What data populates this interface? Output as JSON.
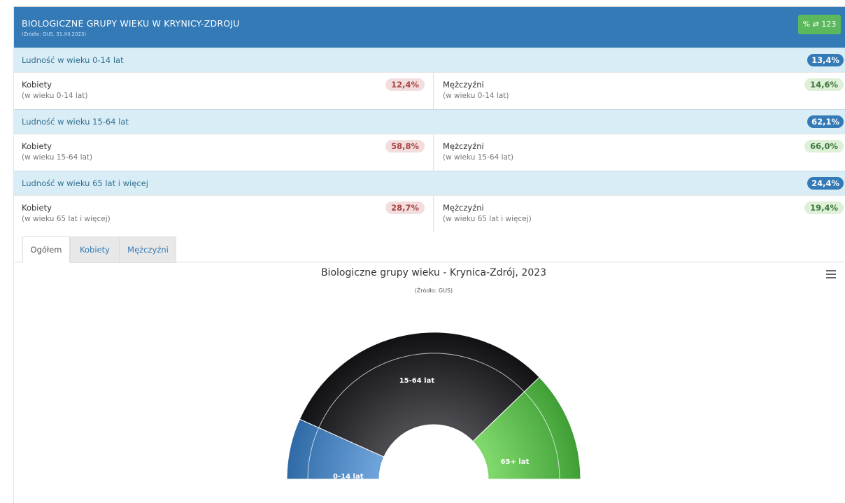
{
  "header": {
    "title": "BIOLOGICZNE GRUPY WIEKU W KRYNICY-ZDROJU",
    "source": "(Źródło: GUS, 31.XII.2023)",
    "toggle_label": "% ⇄ 123"
  },
  "groups": [
    {
      "label": "Ludność w wieku 0-14 lat",
      "total": "13,4%",
      "female": {
        "name": "Kobiety",
        "sub": "(w wieku 0-14 lat)",
        "value": "12,4%"
      },
      "male": {
        "name": "Mężczyźni",
        "sub": "(w wieku 0-14 lat)",
        "value": "14,6%"
      }
    },
    {
      "label": "Ludność w wieku 15-64 lat",
      "total": "62,1%",
      "female": {
        "name": "Kobiety",
        "sub": "(w wieku 15-64 lat)",
        "value": "58,8%"
      },
      "male": {
        "name": "Mężczyźni",
        "sub": "(w wieku 15-64 lat)",
        "value": "66,0%"
      }
    },
    {
      "label": "Ludność w wieku 65 lat i więcej",
      "total": "24,4%",
      "female": {
        "name": "Kobiety",
        "sub": "(w wieku 65 lat i więcej)",
        "value": "28,7%"
      },
      "male": {
        "name": "Mężczyźni",
        "sub": "(w wieku 65 lat i więcej)",
        "value": "19,4%"
      }
    }
  ],
  "tabs": [
    "Ogółem",
    "Kobiety",
    "Mężczyźni"
  ],
  "active_tab": "Ogółem",
  "chart_data": {
    "type": "pie",
    "title": "Biologiczne grupy wieku - Krynica-Zdrój, 2023",
    "subtitle": "(Źródło: GUS)",
    "categories": [
      "0-14 lat",
      "15-64 lat",
      "65+ lat"
    ],
    "values": [
      13.4,
      62.1,
      24.4
    ],
    "colors": [
      "#4a86c5",
      "#26262a",
      "#5cbd4e"
    ],
    "legend": "none"
  },
  "icons": {
    "menu": "hamburger-menu-icon"
  }
}
